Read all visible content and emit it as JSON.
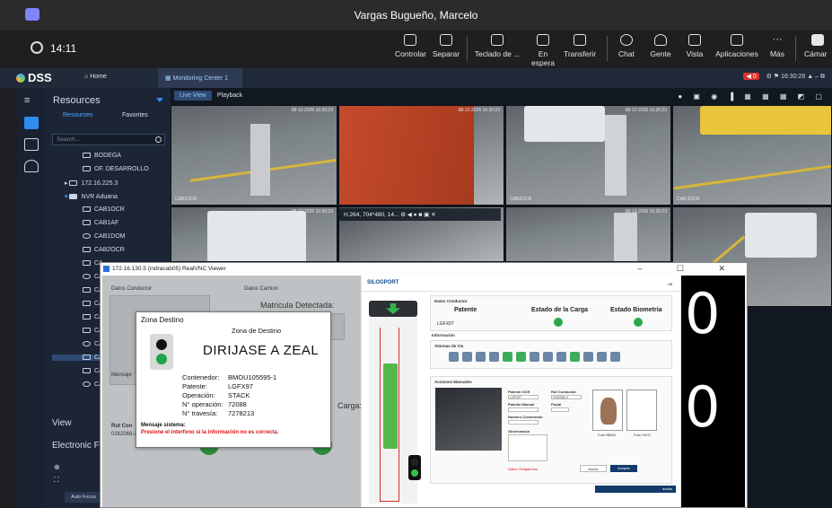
{
  "teams": {
    "caller_name": "Vargas Bugueño, Marcelo",
    "call_time": "14:11",
    "toolbar": [
      {
        "label": "Controlar",
        "icon": "control-icon"
      },
      {
        "label": "Separar",
        "icon": "popout-icon"
      },
      {
        "label": "Teclado de ...",
        "icon": "dialpad-icon"
      },
      {
        "label": "En espera",
        "icon": "hold-icon"
      },
      {
        "label": "Transferir",
        "icon": "transfer-icon"
      },
      {
        "label": "Chat",
        "icon": "chat-icon"
      },
      {
        "label": "Gente",
        "icon": "people-icon",
        "badge": "2"
      },
      {
        "label": "Vista",
        "icon": "view-icon"
      },
      {
        "label": "Aplicaciones",
        "icon": "apps-icon"
      },
      {
        "label": "Más",
        "icon": "more-icon"
      },
      {
        "label": "Cámar",
        "icon": "camera-icon"
      }
    ]
  },
  "dss": {
    "logo": "DSS",
    "home": "Home",
    "tab": "Monitoring Center 1",
    "alarm_count": "0",
    "clock": "16:30:26",
    "sidebar": {
      "title": "Resources",
      "tabs": [
        "Resources",
        "Favorites"
      ],
      "search_placeholder": "Search...",
      "tree": [
        "BODEGA",
        "OF. DESARROLLO",
        "172.16.225.3",
        "NVR Aduana",
        "CAB1OCR",
        "CAB1AF",
        "CAB1DOM",
        "CAB2OCR",
        "CA",
        "CA",
        "CA",
        "CA",
        "CA",
        "CA",
        "CA",
        "CA",
        "CA",
        "CA"
      ],
      "view_label": "View",
      "electronic_label": "Electronic Fo",
      "autofocus": "Auto Focus"
    },
    "view_tabs": [
      "Live View",
      "Playback"
    ],
    "cameras": [
      {
        "label": "CAB1OCR",
        "ts": "08-12-2026 16:30:23"
      },
      {
        "label": "",
        "ts": "08-12-2026 16:30:23"
      },
      {
        "label": "CAB2OCR",
        "ts": "08-12-2026 16:30:23"
      },
      {
        "label": "CAB 3OCR",
        "ts": ""
      },
      {
        "label": "",
        "ts": "08-12-2026 16:30:23"
      },
      {
        "label": "",
        "ts": ""
      },
      {
        "label": "",
        "ts": "08-12-2026 16:30:23"
      },
      {
        "label": "",
        "ts": ""
      }
    ],
    "stream_info": "H.264, 704*480, 14..."
  },
  "vnc": {
    "title": "172.16.130.5 (indracab05) RealVNC Viewer",
    "left_panel": {
      "datos_conductor": "Datos Conductor",
      "datos_camion": "Datos Camion",
      "matricula": "Matricula Detectada:",
      "mensaje": "Mensaje",
      "rut": "Rut Con",
      "rut_val": "0262069-3",
      "carga": "Carga:"
    },
    "zona": {
      "header": "Zona Destino",
      "subtitle": "Zona de Destino",
      "instruction": "DIRIJASE A ZEAL",
      "rows": [
        {
          "key": "Contenedor:",
          "value": "BMOU105595-1"
        },
        {
          "key": "Patente:",
          "value": "LGFX97"
        },
        {
          "key": "Operación:",
          "value": "STACK"
        },
        {
          "key": "N° operación:",
          "value": "72088"
        },
        {
          "key": "N° travesía:",
          "value": "7278213"
        }
      ],
      "msg_label": "Mensaje sistema:",
      "msg_text": "Presione el interfono si la información no es correcta."
    },
    "portal": {
      "logo": "SILOGPORT",
      "status": {
        "section": "Datos Conductor",
        "patente_h": "Patente",
        "patente_v": "LGFX97",
        "estado_carga_h": "Estado de la Carga",
        "estado_bio_h": "Estado Biometria"
      },
      "info": "Información",
      "alarmas": "Alarmas de Vía",
      "acciones": "Acciones Manuales",
      "patente_ocr": "Patente OCR",
      "patente_ocr_val": "LGFX97",
      "patente_manual": "Patente Manual",
      "rut_conductor": "Rut Conductor",
      "rut_val": "0262069-3",
      "facial": "Facial",
      "num_contenedor": "Número Contenedor",
      "observacion": "Observación",
      "campos": "Datos Obligatorios",
      "anular": "Anular",
      "aceptar": "Aceptar",
      "foto_bbdd": "Foto BBDD",
      "foto_vivo": "Foto VIVO",
      "footer": "andes"
    },
    "right_digits": [
      "0",
      "0"
    ]
  }
}
